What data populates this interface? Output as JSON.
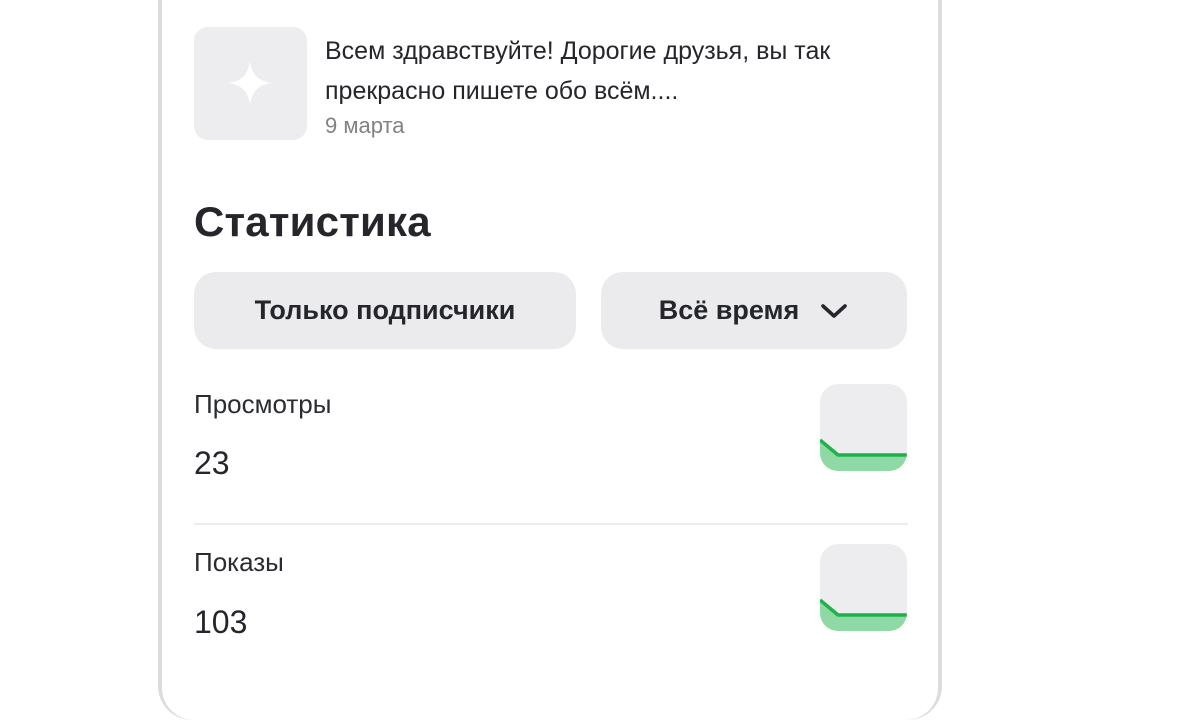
{
  "post": {
    "text": "Всем здравствуйте! Дорогие друзья, вы так прекрасно пишете обо всём....",
    "date": "9 марта",
    "thumbnail_icon": "sparkle-icon"
  },
  "statistics": {
    "title": "Статистика",
    "filters": {
      "audience_label": "Только подписчики",
      "period_label": "Всё время",
      "period_icon": "chevron-down-icon"
    },
    "metrics": [
      {
        "label": "Просмотры",
        "value": "23"
      },
      {
        "label": "Показы",
        "value": "103"
      }
    ]
  },
  "colors": {
    "accent_line": "#1fb24a",
    "accent_fill": "#8fd9a6",
    "chip_bg": "#ebebed",
    "text_muted": "#818186"
  }
}
